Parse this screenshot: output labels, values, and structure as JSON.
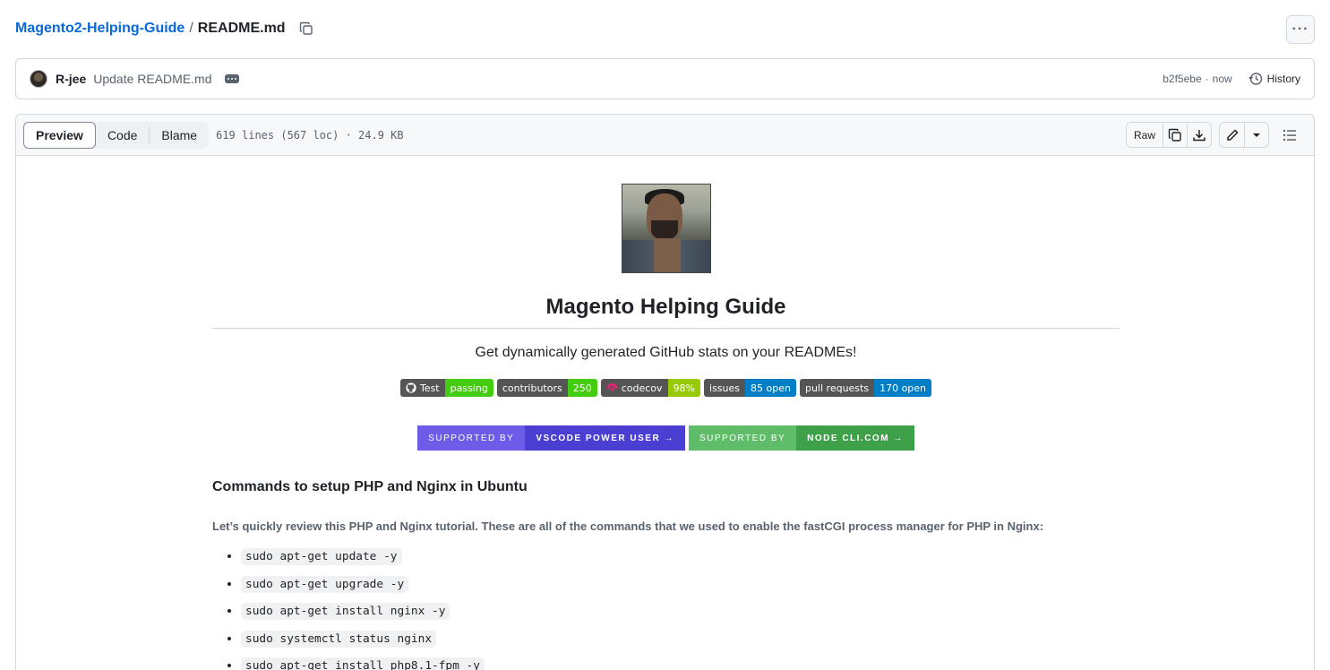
{
  "breadcrumb": {
    "repo": "Magento2-Helping-Guide",
    "separator": "/",
    "file": "README.md"
  },
  "commit": {
    "author": "R-jee",
    "message": "Update README.md",
    "sha": "b2f5ebe",
    "time_sep": "·",
    "time": "now",
    "history_label": "History"
  },
  "file_header": {
    "tabs": [
      {
        "label": "Preview"
      },
      {
        "label": "Code"
      },
      {
        "label": "Blame"
      }
    ],
    "info": "619 lines (567 loc) · 24.9 KB",
    "raw_label": "Raw"
  },
  "readme": {
    "title": "Magento Helping Guide",
    "tagline": "Get dynamically generated GitHub stats on your READMEs!",
    "badges": [
      {
        "label": "Test",
        "value": "passing",
        "color": "#4c1"
      },
      {
        "label": "contributors",
        "value": "250",
        "color": "#4c1"
      },
      {
        "label": "codecov",
        "value": "98%",
        "color": "#97ca00"
      },
      {
        "label": "issues",
        "value": "85 open",
        "color": "#007ec6"
      },
      {
        "label": "pull requests",
        "value": "170 open",
        "color": "#007ec6"
      }
    ],
    "support": [
      {
        "left": "SUPPORTED BY",
        "right": "VSCODE POWER USER →"
      },
      {
        "left": "SUPPORTED BY",
        "right": "NODE CLI.COM →"
      }
    ],
    "section_heading": "Commands to setup PHP and Nginx in Ubuntu",
    "intro": "Let’s quickly review this PHP and Nginx tutorial. These are all of the commands that we used to enable the fastCGI process manager for PHP in Nginx:",
    "commands": [
      "sudo apt-get update -y",
      "sudo apt-get upgrade -y",
      "sudo apt-get install nginx -y",
      "sudo systemctl status nginx",
      "sudo apt-get install php8.1-fpm -y"
    ]
  },
  "colors": {
    "link": "#0969da",
    "muted": "#59636e",
    "border": "#d1d9e0"
  }
}
